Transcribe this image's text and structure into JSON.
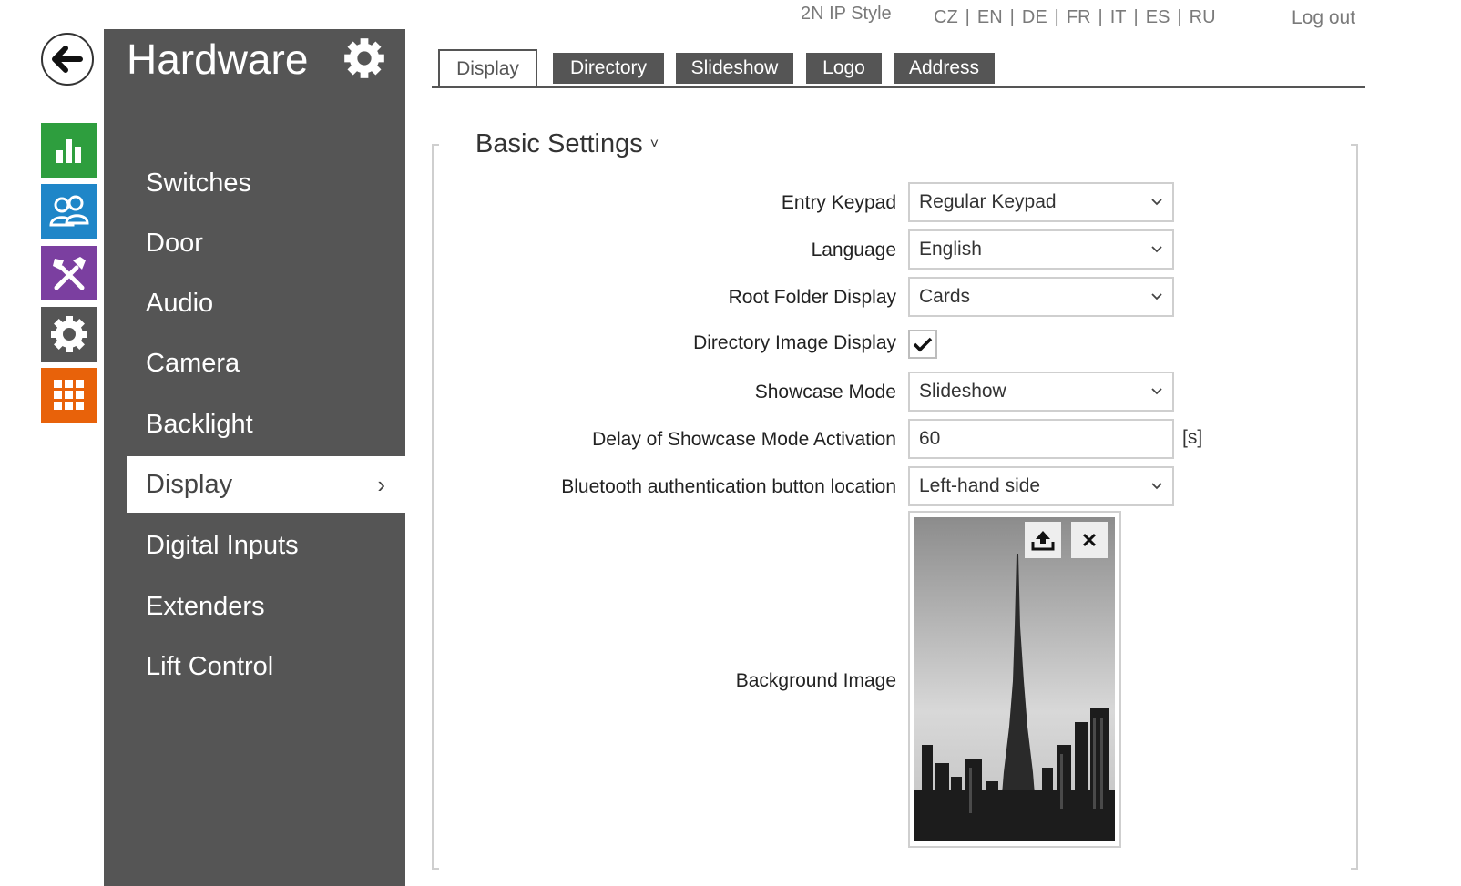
{
  "header": {
    "style_link": "2N IP Style",
    "languages": [
      "CZ",
      "EN",
      "DE",
      "FR",
      "IT",
      "ES",
      "RU"
    ],
    "logout": "Log out"
  },
  "icon_nav": [
    {
      "name": "status-icon",
      "color": "#2e9e3e"
    },
    {
      "name": "directory-icon",
      "color": "#1f86c8"
    },
    {
      "name": "hardware-icon",
      "color": "#7b3fa0"
    },
    {
      "name": "system-icon",
      "color": "#555555"
    },
    {
      "name": "services-icon",
      "color": "#e8620a"
    }
  ],
  "sidebar": {
    "title": "Hardware",
    "items": [
      {
        "label": "Switches"
      },
      {
        "label": "Door"
      },
      {
        "label": "Audio"
      },
      {
        "label": "Camera"
      },
      {
        "label": "Backlight"
      },
      {
        "label": "Display",
        "active": true,
        "chevron": "›"
      },
      {
        "label": "Digital Inputs"
      },
      {
        "label": "Extenders"
      },
      {
        "label": "Lift Control"
      }
    ]
  },
  "tabs": [
    "Display",
    "Directory",
    "Slideshow",
    "Logo",
    "Address"
  ],
  "active_tab": "Display",
  "section": {
    "title": "Basic Settings",
    "chevron": "˅"
  },
  "form": {
    "entry_keypad": {
      "label": "Entry Keypad",
      "value": "Regular Keypad"
    },
    "language": {
      "label": "Language",
      "value": "English"
    },
    "root_folder_display": {
      "label": "Root Folder Display",
      "value": "Cards"
    },
    "directory_image_display": {
      "label": "Directory Image Display",
      "checked": true
    },
    "showcase_mode": {
      "label": "Showcase Mode",
      "value": "Slideshow"
    },
    "delay_activation": {
      "label": "Delay of Showcase Mode Activation",
      "value": "60",
      "unit": "[s]"
    },
    "bt_button_location": {
      "label": "Bluetooth authentication button location",
      "value": "Left-hand side"
    },
    "background_image": {
      "label": "Background Image"
    }
  },
  "colors": {
    "sidebar_bg": "#555555",
    "accent_dark": "#555555",
    "border": "#cfcfcf"
  }
}
